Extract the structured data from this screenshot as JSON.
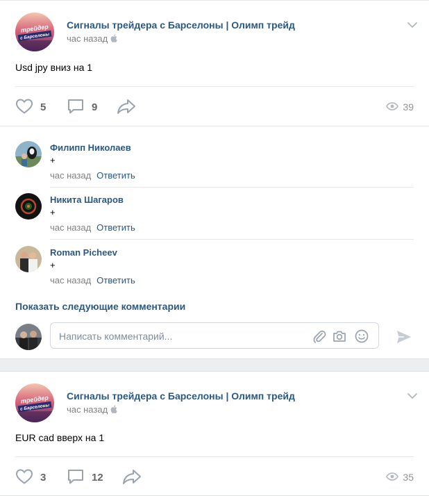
{
  "colors": {
    "link": "#2a5885",
    "muted": "#828282",
    "icon": "#99a2ad",
    "bg": "#edeef0"
  },
  "posts": [
    {
      "author": "Сигналы трейдера с Барселоны | Олимп трейд",
      "time": "час назад",
      "avatar_text": [
        "трейдер",
        "с Барселоны"
      ],
      "text": "Usd jpy вниз на 1",
      "likes": "5",
      "comments": "9",
      "views": "39"
    },
    {
      "author": "Сигналы трейдера с Барселоны | Олимп трейд",
      "time": "час назад",
      "avatar_text": [
        "трейдер",
        "с Барселоны"
      ],
      "text": "EUR cad вверх на 1",
      "likes": "3",
      "comments": "12",
      "views": "35"
    }
  ],
  "comments": [
    {
      "author": "Филипп Николаев",
      "text": "+",
      "time": "час назад",
      "reply": "Ответить"
    },
    {
      "author": "Никита Шагаров",
      "text": "+",
      "time": "час назад",
      "reply": "Ответить"
    },
    {
      "author": "Roman Picheev",
      "text": "+",
      "time": "час назад",
      "reply": "Ответить"
    }
  ],
  "show_more": "Показать следующие комментарии",
  "comment_input": {
    "placeholder": "Написать комментарий...",
    "value": ""
  }
}
